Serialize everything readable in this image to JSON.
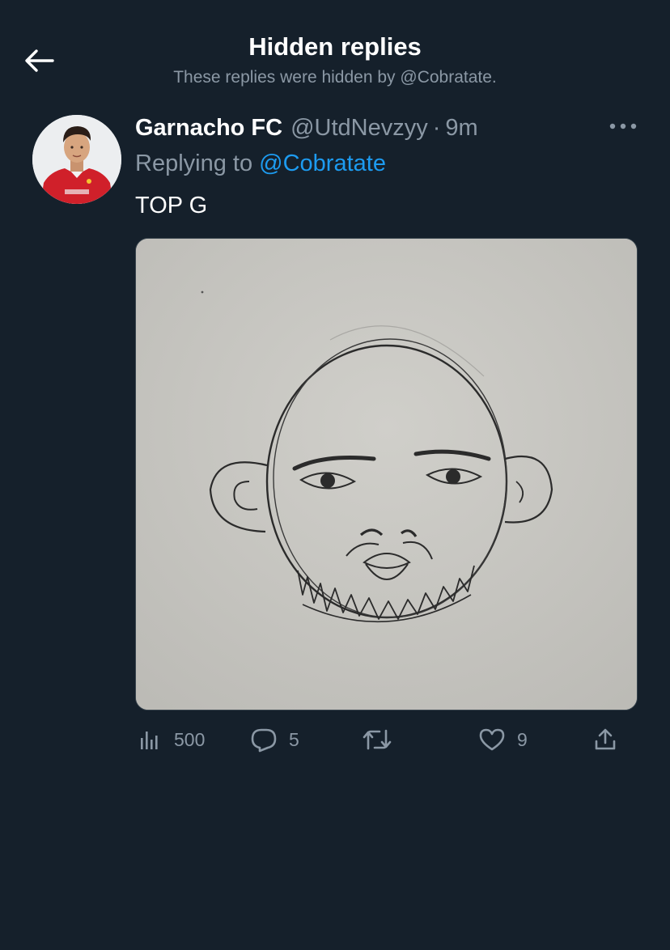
{
  "header": {
    "title": "Hidden replies",
    "subtitle": "These replies were hidden by @Cobratate."
  },
  "tweet": {
    "display_name": "Garnacho FC",
    "handle": "@UtdNevzyy",
    "separator": "·",
    "time": "9m",
    "replying_prefix": "Replying to",
    "replying_to": "@Cobratate",
    "text": "TOP G",
    "media_alt": "pencil sketch of a bald face",
    "stats": {
      "views": "500",
      "replies": "5",
      "retweets": "",
      "likes": "9"
    }
  },
  "icons": {
    "back": "arrow-left-icon",
    "more": "more-horizontal-icon",
    "views": "analytics-icon",
    "reply": "reply-icon",
    "retweet": "retweet-icon",
    "like": "heart-icon",
    "share": "share-icon"
  },
  "colors": {
    "background": "#15202b",
    "secondary_text": "#8b98a5",
    "accent": "#1d9bf0"
  }
}
